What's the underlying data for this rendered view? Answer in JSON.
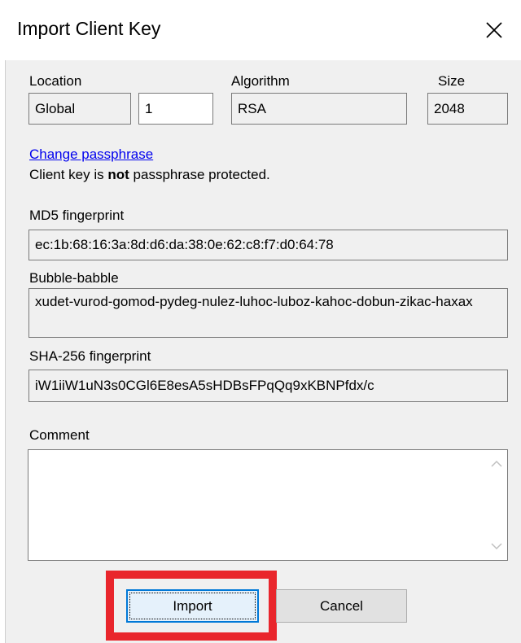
{
  "window": {
    "title": "Import Client Key",
    "close_symbol": "✕"
  },
  "key_info": {
    "location_label": "Location",
    "location_value": "Global",
    "index_value": "1",
    "algorithm_label": "Algorithm",
    "algorithm_value": "RSA",
    "size_label": "Size",
    "size_value": "2048"
  },
  "passphrase": {
    "link_text": "Change passphrase",
    "status_prefix": "Client key is ",
    "status_bold": "not",
    "status_suffix": " passphrase protected."
  },
  "fingerprints": {
    "md5_label": "MD5 fingerprint",
    "md5_value": "ec:1b:68:16:3a:8d:d6:da:38:0e:62:c8:f7:d0:64:78",
    "bubble_label": "Bubble-babble",
    "bubble_value": "xudet-vurod-gomod-pydeg-nulez-luhoc-luboz-kahoc-dobun-zikac-haxax",
    "sha256_label": "SHA-256 fingerprint",
    "sha256_value": "iW1iiW1uN3s0CGl6E8esA5sHDBsFPqQq9xKBNPfdx/c"
  },
  "comment": {
    "label": "Comment",
    "value": ""
  },
  "buttons": {
    "import_label": "Import",
    "cancel_label": "Cancel"
  },
  "colors": {
    "highlight_frame": "#e9262c",
    "focus_border": "#0078d7",
    "link": "#0000ee"
  }
}
